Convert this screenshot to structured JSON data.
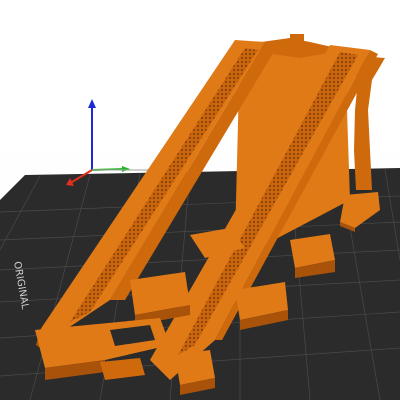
{
  "viewport": {
    "background": "#ffffff",
    "bed_label": "ORIGINAL",
    "bed_color": "#2b2b2b",
    "grid_color": "#4a4a4a",
    "axis_colors": {
      "x": "#e0301e",
      "y": "#25b825",
      "z": "#1a2ad6"
    }
  },
  "model": {
    "color_light": "#e07a17",
    "color_mid": "#cf6a0c",
    "color_dark": "#a9520a"
  }
}
